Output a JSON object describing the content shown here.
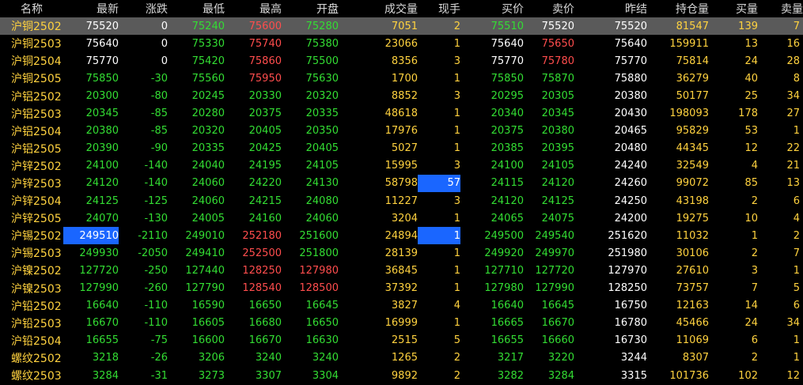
{
  "columns": [
    "名称",
    "最新",
    "涨跌",
    "最低",
    "最高",
    "开盘",
    "成交量",
    "现手",
    "买价",
    "卖价",
    "昨结",
    "持仓量",
    "买量",
    "卖量"
  ],
  "colors": {
    "up": "#ff4d4d",
    "down": "#33dd33",
    "flat": "#ffffff",
    "yellow": "#ffd23f",
    "blue": "#5a8cff",
    "header": "#d9d9d9"
  },
  "rows": [
    {
      "name": "沪铜2502",
      "last": "75520",
      "chg": "0",
      "low": "75240",
      "high": "75600",
      "open": "75280",
      "vol": "7051",
      "cur": "2",
      "bid": "75510",
      "ask": "75520",
      "prev": "75520",
      "oi": "81547",
      "bq": "139",
      "aq": "7",
      "sel": true
    },
    {
      "name": "沪铜2503",
      "last": "75640",
      "chg": "0",
      "low": "75330",
      "high": "75740",
      "open": "75380",
      "vol": "23066",
      "cur": "1",
      "bid": "75640",
      "ask": "75650",
      "prev": "75640",
      "oi": "159911",
      "bq": "13",
      "aq": "16"
    },
    {
      "name": "沪铜2504",
      "last": "75770",
      "chg": "0",
      "low": "75420",
      "high": "75860",
      "open": "75500",
      "vol": "8356",
      "cur": "3",
      "bid": "75770",
      "ask": "75780",
      "prev": "75770",
      "oi": "75814",
      "bq": "24",
      "aq": "28"
    },
    {
      "name": "沪铜2505",
      "last": "75850",
      "chg": "-30",
      "low": "75560",
      "high": "75950",
      "open": "75630",
      "vol": "1700",
      "cur": "1",
      "bid": "75850",
      "ask": "75870",
      "prev": "75880",
      "oi": "36279",
      "bq": "40",
      "aq": "8"
    },
    {
      "name": "沪铝2502",
      "last": "20300",
      "chg": "-80",
      "low": "20245",
      "high": "20330",
      "open": "20320",
      "vol": "8852",
      "cur": "3",
      "bid": "20295",
      "ask": "20305",
      "prev": "20380",
      "oi": "50177",
      "bq": "25",
      "aq": "34"
    },
    {
      "name": "沪铝2503",
      "last": "20345",
      "chg": "-85",
      "low": "20280",
      "high": "20375",
      "open": "20335",
      "vol": "48618",
      "cur": "1",
      "bid": "20340",
      "ask": "20345",
      "prev": "20430",
      "oi": "198093",
      "bq": "178",
      "aq": "27"
    },
    {
      "name": "沪铝2504",
      "last": "20380",
      "chg": "-85",
      "low": "20320",
      "high": "20405",
      "open": "20350",
      "vol": "17976",
      "cur": "1",
      "bid": "20375",
      "ask": "20380",
      "prev": "20465",
      "oi": "95829",
      "bq": "53",
      "aq": "1"
    },
    {
      "name": "沪铝2505",
      "last": "20390",
      "chg": "-90",
      "low": "20335",
      "high": "20425",
      "open": "20405",
      "vol": "5027",
      "cur": "1",
      "bid": "20385",
      "ask": "20395",
      "prev": "20480",
      "oi": "44345",
      "bq": "12",
      "aq": "22"
    },
    {
      "name": "沪锌2502",
      "last": "24100",
      "chg": "-140",
      "low": "24040",
      "high": "24195",
      "open": "24105",
      "vol": "15995",
      "cur": "3",
      "bid": "24100",
      "ask": "24105",
      "prev": "24240",
      "oi": "32549",
      "bq": "4",
      "aq": "21"
    },
    {
      "name": "沪锌2503",
      "last": "24120",
      "chg": "-140",
      "low": "24060",
      "high": "24220",
      "open": "24130",
      "vol": "58798",
      "cur": "57",
      "bid": "24115",
      "ask": "24120",
      "prev": "24260",
      "oi": "99072",
      "bq": "85",
      "aq": "13",
      "curhl": true
    },
    {
      "name": "沪锌2504",
      "last": "24125",
      "chg": "-125",
      "low": "24060",
      "high": "24215",
      "open": "24080",
      "vol": "11227",
      "cur": "3",
      "bid": "24120",
      "ask": "24125",
      "prev": "24250",
      "oi": "43198",
      "bq": "2",
      "aq": "6"
    },
    {
      "name": "沪锌2505",
      "last": "24070",
      "chg": "-130",
      "low": "24005",
      "high": "24160",
      "open": "24060",
      "vol": "3204",
      "cur": "1",
      "bid": "24065",
      "ask": "24075",
      "prev": "24200",
      "oi": "19275",
      "bq": "10",
      "aq": "4"
    },
    {
      "name": "沪锡2502",
      "last": "249510",
      "chg": "-2110",
      "low": "249010",
      "high": "252180",
      "open": "251600",
      "vol": "24894",
      "cur": "1",
      "bid": "249500",
      "ask": "249540",
      "prev": "251620",
      "oi": "11032",
      "bq": "1",
      "aq": "2",
      "lasthl": true,
      "curhl": true
    },
    {
      "name": "沪锡2503",
      "last": "249930",
      "chg": "-2050",
      "low": "249410",
      "high": "252500",
      "open": "251800",
      "vol": "28139",
      "cur": "1",
      "bid": "249920",
      "ask": "249970",
      "prev": "251980",
      "oi": "30106",
      "bq": "2",
      "aq": "7"
    },
    {
      "name": "沪镍2502",
      "last": "127720",
      "chg": "-250",
      "low": "127440",
      "high": "128250",
      "open": "127980",
      "vol": "36845",
      "cur": "1",
      "bid": "127710",
      "ask": "127720",
      "prev": "127970",
      "oi": "27610",
      "bq": "3",
      "aq": "1"
    },
    {
      "name": "沪镍2503",
      "last": "127990",
      "chg": "-260",
      "low": "127790",
      "high": "128540",
      "open": "128500",
      "vol": "37392",
      "cur": "1",
      "bid": "127980",
      "ask": "127990",
      "prev": "128250",
      "oi": "73757",
      "bq": "7",
      "aq": "5"
    },
    {
      "name": "沪铅2502",
      "last": "16640",
      "chg": "-110",
      "low": "16590",
      "high": "16650",
      "open": "16645",
      "vol": "3827",
      "cur": "4",
      "bid": "16640",
      "ask": "16645",
      "prev": "16750",
      "oi": "12163",
      "bq": "14",
      "aq": "6"
    },
    {
      "name": "沪铅2503",
      "last": "16670",
      "chg": "-110",
      "low": "16605",
      "high": "16680",
      "open": "16650",
      "vol": "16999",
      "cur": "1",
      "bid": "16665",
      "ask": "16670",
      "prev": "16780",
      "oi": "45466",
      "bq": "24",
      "aq": "34"
    },
    {
      "name": "沪铅2504",
      "last": "16655",
      "chg": "-75",
      "low": "16600",
      "high": "16670",
      "open": "16630",
      "vol": "2515",
      "cur": "5",
      "bid": "16655",
      "ask": "16660",
      "prev": "16730",
      "oi": "11069",
      "bq": "6",
      "aq": "1"
    },
    {
      "name": "螺纹2502",
      "last": "3218",
      "chg": "-26",
      "low": "3206",
      "high": "3240",
      "open": "3240",
      "vol": "1265",
      "cur": "2",
      "bid": "3217",
      "ask": "3220",
      "prev": "3244",
      "oi": "8307",
      "bq": "2",
      "aq": "1"
    },
    {
      "name": "螺纹2503",
      "last": "3284",
      "chg": "-31",
      "low": "3273",
      "high": "3307",
      "open": "3304",
      "vol": "9892",
      "cur": "2",
      "bid": "3282",
      "ask": "3284",
      "prev": "3315",
      "oi": "101736",
      "bq": "102",
      "aq": "12"
    }
  ]
}
